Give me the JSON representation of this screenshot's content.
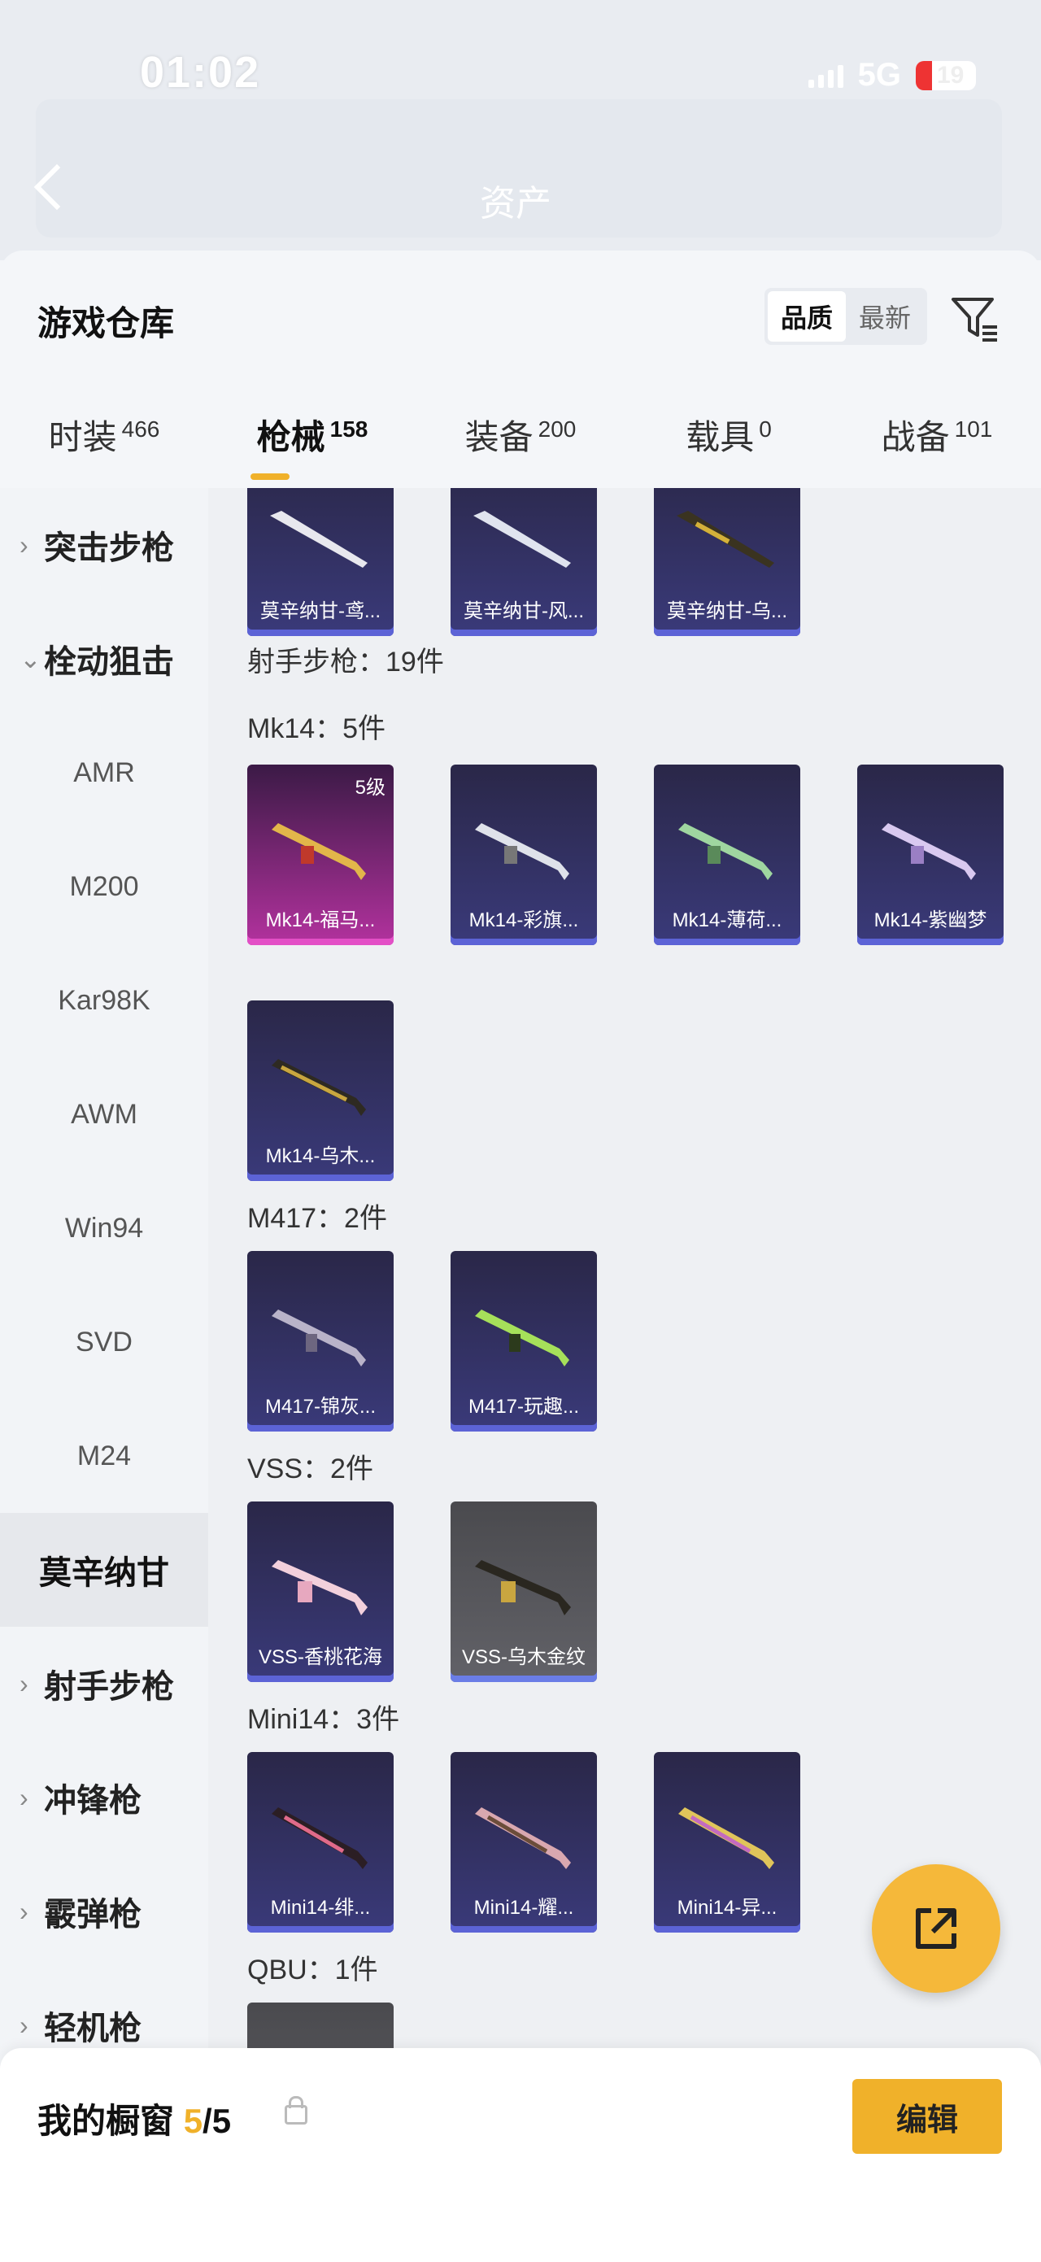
{
  "status_bar": {
    "time": "01:02",
    "network": "5G",
    "battery": "19"
  },
  "background_page": {
    "title": "资产"
  },
  "header": {
    "title": "游戏仓库",
    "sort_options": [
      "品质",
      "最新"
    ],
    "active_sort": "品质"
  },
  "tabs": [
    {
      "label": "时装",
      "count": "466"
    },
    {
      "label": "枪械",
      "count": "158",
      "active": true
    },
    {
      "label": "装备",
      "count": "200"
    },
    {
      "label": "载具",
      "count": "0"
    },
    {
      "label": "战备",
      "count": "101"
    }
  ],
  "side_nav": [
    {
      "label": "突击步枪",
      "type": "category"
    },
    {
      "label": "栓动狙击",
      "type": "category",
      "expanded": true
    },
    {
      "label": "AMR",
      "type": "sub"
    },
    {
      "label": "M200",
      "type": "sub"
    },
    {
      "label": "Kar98K",
      "type": "sub"
    },
    {
      "label": "AWM",
      "type": "sub"
    },
    {
      "label": "Win94",
      "type": "sub"
    },
    {
      "label": "SVD",
      "type": "sub"
    },
    {
      "label": "M24",
      "type": "sub"
    },
    {
      "label": "莫辛纳甘",
      "type": "sub",
      "selected": true
    },
    {
      "label": "射手步枪",
      "type": "category"
    },
    {
      "label": "冲锋枪",
      "type": "category"
    },
    {
      "label": "霰弹枪",
      "type": "category"
    },
    {
      "label": "轻机枪",
      "type": "category"
    }
  ],
  "groups": {
    "mosin": {
      "items": [
        "莫辛纳甘-鸢...",
        "莫辛纳甘-风...",
        "莫辛纳甘-乌..."
      ]
    },
    "dmr_header": "射手步枪：19件",
    "mk14": {
      "title": "Mk14：5件",
      "items": [
        "Mk14-福马...",
        "Mk14-彩旗...",
        "Mk14-薄荷...",
        "Mk14-紫幽梦",
        "Mk14-乌木..."
      ],
      "level_badge": "5级"
    },
    "m417": {
      "title": "M417：2件",
      "items": [
        "M417-锦灰...",
        "M417-玩趣..."
      ]
    },
    "vss": {
      "title": "VSS：2件",
      "items": [
        "VSS-香桃花海",
        "VSS-乌木金纹"
      ]
    },
    "mini14": {
      "title": "Mini14：3件",
      "items": [
        "Mini14-绯...",
        "Mini14-耀...",
        "Mini14-异..."
      ]
    },
    "qbu": {
      "title": "QBU：1件"
    }
  },
  "bottom_bar": {
    "label": "我的橱窗",
    "current": "5",
    "total": "/5",
    "edit_label": "编辑"
  },
  "colors": {
    "accent": "#f0b12a",
    "card_blue": "#3a3a7a",
    "card_gold": "#b3329e"
  }
}
